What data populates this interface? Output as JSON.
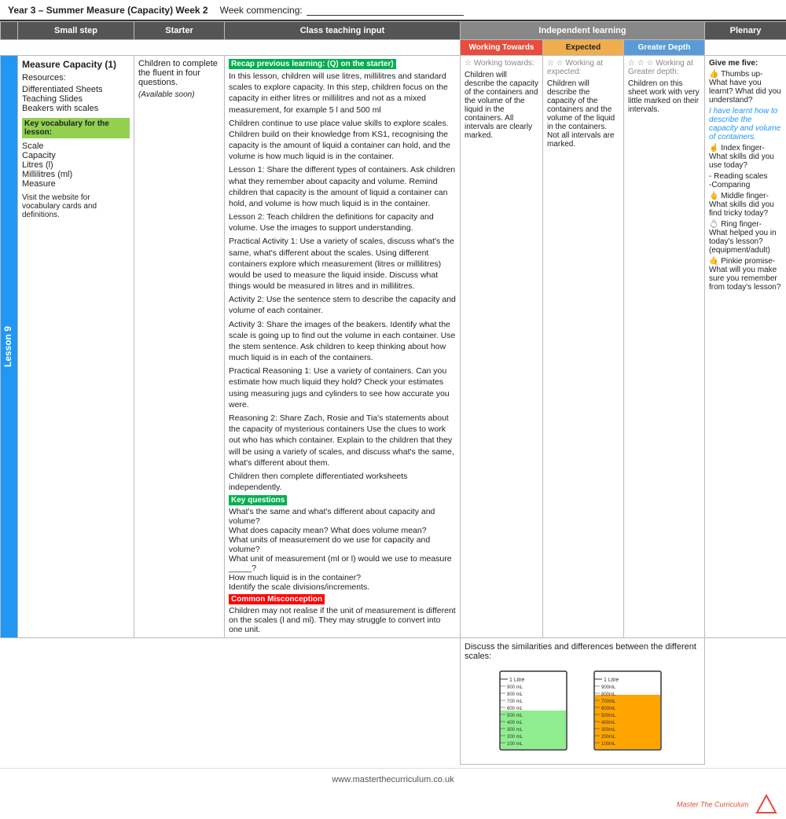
{
  "header": {
    "title": "Year 3 – Summer Measure (Capacity)  Week 2",
    "week_label": "Week commencing:",
    "week_line": "___________________________"
  },
  "columns": {
    "small_step": "Small step",
    "starter": "Starter",
    "teaching": "Class teaching input",
    "independent": "Independent learning",
    "plenary": "Plenary"
  },
  "independent_sub": {
    "working_towards": "Working Towards",
    "expected": "Expected",
    "greater_depth": "Greater Depth"
  },
  "lesson_badge": "Lesson 9",
  "small_step": {
    "title": "Measure Capacity (1)",
    "resources_label": "Resources:",
    "resources": [
      "Differentiated Sheets",
      "Teaching Slides",
      "Beakers with scales"
    ],
    "key_vocab_label": "Key vocabulary for the lesson:",
    "vocab": [
      "Scale",
      "Capacity",
      "Litres (l)",
      "Millilitres (ml)",
      "Measure"
    ],
    "visit_text": "Visit the website for vocabulary cards and definitions."
  },
  "starter": {
    "text": "Children to complete the fluent in four questions.",
    "available": "(Available soon)"
  },
  "teaching": {
    "recap_label": "Recap previous learning: (Q) on the starter)",
    "para1": "In this lesson, children will use litres, millilitres and standard scales to explore capacity. In this step, children focus on  the capacity in either litres or millilitres and not as a mixed measurement, for example 5 l and 500 ml",
    "para2": "Children continue to use place value skills to explore scales. Children build on their knowledge from KS1, recognising the capacity is the amount of liquid a container can hold, and the volume is how much liquid  is in the container.",
    "lesson1": "Lesson 1: Share the different types of containers. Ask children what they remember about capacity and volume.  Remind children that capacity is the amount of liquid a container can hold, and volume is how much liquid is in the container.",
    "lesson2": "Lesson 2: Teach children the definitions for capacity and volume. Use the images to support understanding.",
    "activity1": "Practical Activity 1: Use a variety of scales, discuss what's the same, what's different about the scales. Using different containers explore which measurement (litres or millilitres) would be used to measure the liquid inside. Discuss what things would be measured in litres and in millilitres.",
    "activity2": "Activity 2: Use the sentence stem to describe the capacity and volume of each container.",
    "activity3": "Activity 3: Share the images of the beakers. Identify what the scale is going up to find out the volume in each container. Use the stem sentence. Ask children to keep thinking about how much liquid is in each of the containers.",
    "practical1": "Practical Reasoning 1: Use a variety of containers. Can you estimate how much liquid they hold? Check your estimates using measuring jugs and cylinders to see how accurate you were.",
    "reasoning2": "Reasoning 2: Share Zach, Rosie and Tia's statements about the capacity of mysterious containers Use the clues to work out who has which container. Explain to the children that they will be using a variety of scales, and discuss what's the same, what's different about them.",
    "complete": "Children then complete differentiated worksheets independently.",
    "key_questions_label": "Key questions",
    "q1": "What's the same and what's different about capacity and volume?",
    "q2": "What does capacity mean? What does volume mean?",
    "q3": "What units of measurement do we use for capacity and volume?",
    "q4": "What unit of measurement (ml or l) would we use to measure _____?",
    "q5": "How much liquid is in the container?",
    "q6": "Identify the scale divisions/increments.",
    "misconception_label": "Common Misconception",
    "misconception": "Children may not realise if the unit of measurement is different on the scales (l and ml). They may struggle to convert into one unit."
  },
  "working_towards": {
    "star_label": "☆ Working towards:",
    "text": "Children will describe the capacity of the containers and the volume of the liquid in the containers. All intervals are clearly marked."
  },
  "expected": {
    "star_label": "☆ ☆ Working at expected:",
    "text": "Children will describe the capacity of the containers and the volume of the liquid in the containers. Not all intervals are marked."
  },
  "greater_depth": {
    "star_label": "☆ ☆ ☆ Working at Greater depth:",
    "text": "Children on this sheet work with very little marked on their intervals."
  },
  "similarities": "Discuss the similarities and differences between the different scales:",
  "plenary": {
    "title": "Give me five:",
    "thumb": "👍 Thumbs up- What have you learnt? What did you understand?",
    "learnt": "I have learnt how to describe the capacity and volume of containers.",
    "index": "☝ Index finger- What skills did you use today?",
    "reading": "- Reading scales",
    "comparing": "-Comparing",
    "middle": "🖕 Middle finger- What skills did you find tricky today?",
    "ring": "💍 Ring finger- What helped you in today's lesson? (equipment/adult)",
    "pinkie": "🤙 Pinkie promise- What will you make sure you remember from today's lesson?"
  },
  "footer": {
    "url": "www.masterthecurriculum.co.uk"
  },
  "beakers": [
    {
      "label": "1 Litre beaker",
      "marks": [
        "1 Litre",
        "900 mL",
        "800 mL",
        "700 mL",
        "600 mL",
        "500 mL",
        "400 mL",
        "300 mL",
        "200 mL",
        "100 mL"
      ],
      "fill_color": "#90EE90",
      "fill_percent": 45
    },
    {
      "label": "1 Litre beaker (orange)",
      "marks": [
        "1 Litre",
        "900mL",
        "800mL",
        "700mL",
        "600mL",
        "500mL",
        "400mL",
        "300mL",
        "200mL",
        "100mL"
      ],
      "fill_color": "#FFA500",
      "fill_percent": 70
    }
  ]
}
